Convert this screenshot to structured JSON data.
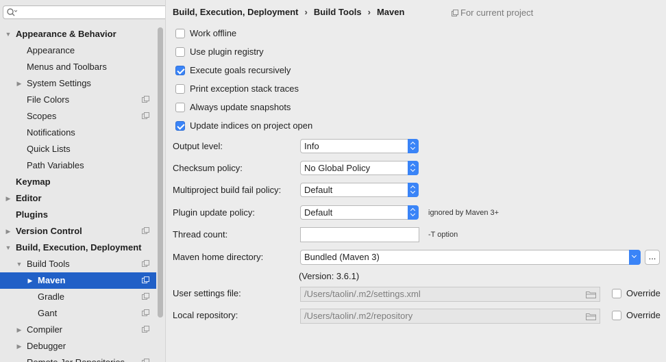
{
  "search": {
    "placeholder": ""
  },
  "sidebar": {
    "items": [
      {
        "label": "Appearance & Behavior",
        "level": 0,
        "bold": true,
        "arrow": "down",
        "project": false
      },
      {
        "label": "Appearance",
        "level": 1,
        "bold": false,
        "arrow": "",
        "project": false
      },
      {
        "label": "Menus and Toolbars",
        "level": 1,
        "bold": false,
        "arrow": "",
        "project": false
      },
      {
        "label": "System Settings",
        "level": 1,
        "bold": false,
        "arrow": "right",
        "project": false
      },
      {
        "label": "File Colors",
        "level": 1,
        "bold": false,
        "arrow": "",
        "project": true
      },
      {
        "label": "Scopes",
        "level": 1,
        "bold": false,
        "arrow": "",
        "project": true
      },
      {
        "label": "Notifications",
        "level": 1,
        "bold": false,
        "arrow": "",
        "project": false
      },
      {
        "label": "Quick Lists",
        "level": 1,
        "bold": false,
        "arrow": "",
        "project": false
      },
      {
        "label": "Path Variables",
        "level": 1,
        "bold": false,
        "arrow": "",
        "project": false
      },
      {
        "label": "Keymap",
        "level": 0,
        "bold": true,
        "arrow": "",
        "project": false
      },
      {
        "label": "Editor",
        "level": 0,
        "bold": true,
        "arrow": "right",
        "project": false
      },
      {
        "label": "Plugins",
        "level": 0,
        "bold": true,
        "arrow": "",
        "project": false
      },
      {
        "label": "Version Control",
        "level": 0,
        "bold": true,
        "arrow": "right",
        "project": true
      },
      {
        "label": "Build, Execution, Deployment",
        "level": 0,
        "bold": true,
        "arrow": "down",
        "project": false
      },
      {
        "label": "Build Tools",
        "level": 1,
        "bold": false,
        "arrow": "down",
        "project": true
      },
      {
        "label": "Maven",
        "level": 2,
        "bold": true,
        "arrow": "right",
        "project": true,
        "selected": true
      },
      {
        "label": "Gradle",
        "level": 2,
        "bold": false,
        "arrow": "",
        "project": true
      },
      {
        "label": "Gant",
        "level": 2,
        "bold": false,
        "arrow": "",
        "project": true
      },
      {
        "label": "Compiler",
        "level": 1,
        "bold": false,
        "arrow": "right",
        "project": true
      },
      {
        "label": "Debugger",
        "level": 1,
        "bold": false,
        "arrow": "right",
        "project": false
      },
      {
        "label": "Remote Jar Repositories",
        "level": 1,
        "bold": false,
        "arrow": "",
        "project": true
      }
    ]
  },
  "breadcrumb": {
    "items": [
      "Build, Execution, Deployment",
      "Build Tools",
      "Maven"
    ],
    "separator": "›",
    "scope_label": "For current project"
  },
  "options": [
    {
      "label": "Work offline",
      "checked": false
    },
    {
      "label": "Use plugin registry",
      "checked": false
    },
    {
      "label": "Execute goals recursively",
      "checked": true
    },
    {
      "label": "Print exception stack traces",
      "checked": false
    },
    {
      "label": "Always update snapshots",
      "checked": false
    },
    {
      "label": "Update indices on project open",
      "checked": true
    }
  ],
  "form": {
    "output_level": {
      "label": "Output level:",
      "value": "Info"
    },
    "checksum_policy": {
      "label": "Checksum policy:",
      "value": "No Global Policy"
    },
    "multiproject_fail_policy": {
      "label": "Multiproject build fail policy:",
      "value": "Default"
    },
    "plugin_update_policy": {
      "label": "Plugin update policy:",
      "value": "Default",
      "hint": "ignored by Maven 3+"
    },
    "thread_count": {
      "label": "Thread count:",
      "value": "",
      "hint": "-T option"
    },
    "maven_home": {
      "label": "Maven home directory:",
      "value": "Bundled (Maven 3)",
      "browse_label": "...",
      "version": "(Version: 3.6.1)"
    },
    "user_settings_file": {
      "label": "User settings file:",
      "value": "/Users/taolin/.m2/settings.xml",
      "override_label": "Override",
      "override_checked": false
    },
    "local_repository": {
      "label": "Local repository:",
      "value": "/Users/taolin/.m2/repository",
      "override_label": "Override",
      "override_checked": false
    }
  },
  "colors": {
    "accent": "#3a84f7",
    "selection": "#2160c7"
  }
}
